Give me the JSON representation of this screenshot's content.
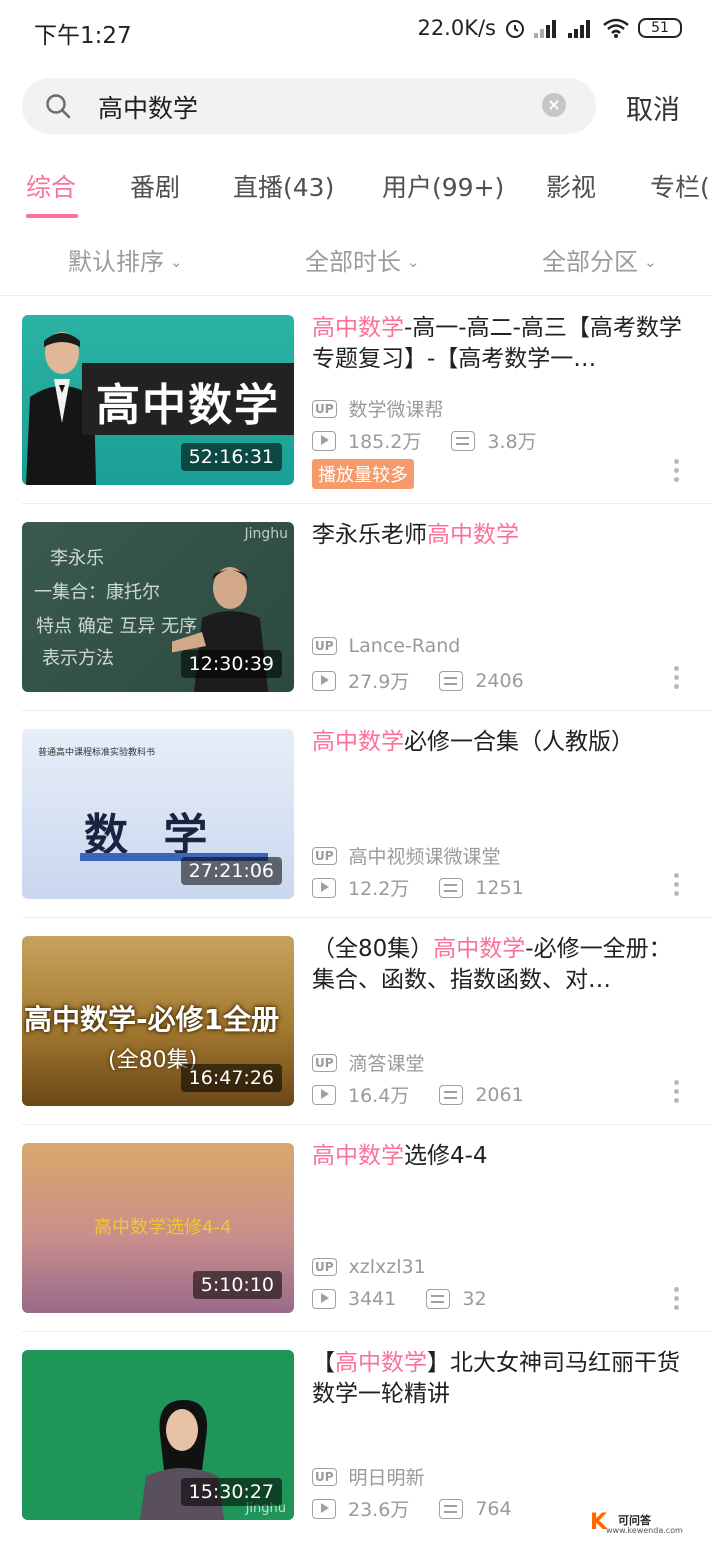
{
  "status_bar": {
    "time": "下午1:27",
    "network_speed": "22.0K/s",
    "battery": "51",
    "icons": [
      "alarm-icon",
      "signal-icon",
      "signal-icon",
      "wifi-icon",
      "battery-icon"
    ]
  },
  "search": {
    "query": "高中数学",
    "cancel_label": "取消"
  },
  "tabs": [
    {
      "label": "综合",
      "active": true
    },
    {
      "label": "番剧",
      "active": false
    },
    {
      "label": "直播(43)",
      "active": false
    },
    {
      "label": "用户(99+)",
      "active": false
    },
    {
      "label": "影视",
      "active": false
    },
    {
      "label": "专栏(",
      "active": false
    }
  ],
  "filters": {
    "sort": "默认排序",
    "duration": "全部时长",
    "zone": "全部分区"
  },
  "results": [
    {
      "title_hl": "高中数学",
      "title_rest": "-高一-高二-高三【高考数学专题复习】-【高考数学一…",
      "uploader": "数学微课帮",
      "views": "185.2万",
      "danmaku": "3.8万",
      "badge": "播放量较多",
      "duration": "52:16:31",
      "thumb_text": "高中数学"
    },
    {
      "title_pre": "李永乐老师",
      "title_hl": "高中数学",
      "uploader": "Lance-Rand",
      "views": "27.9万",
      "danmaku": "2406",
      "duration": "12:30:39",
      "thumb_text": "Jinghu"
    },
    {
      "title_hl": "高中数学",
      "title_rest": "必修一合集（人教版）",
      "uploader": "高中视频课微课堂",
      "views": "12.2万",
      "danmaku": "1251",
      "duration": "27:21:06",
      "thumb_text": "数 学"
    },
    {
      "title_pre": "（全80集）",
      "title_hl": "高中数学",
      "title_rest": "-必修一全册：集合、函数、指数函数、对…",
      "uploader": "滴答课堂",
      "views": "16.4万",
      "danmaku": "2061",
      "duration": "16:47:26",
      "thumb_text": "高中数学-必修1全册",
      "thumb_sub": "(全80集)"
    },
    {
      "title_hl": "高中数学",
      "title_rest": "选修4-4",
      "uploader": "xzlxzl31",
      "views": "3441",
      "danmaku": "32",
      "duration": "5:10:10",
      "thumb_text": "高中数学选修4-4"
    },
    {
      "title_pre": "【",
      "title_hl": "高中数学",
      "title_rest": "】北大女神司马红丽干货数学一轮精讲",
      "uploader": "明日明新",
      "views": "23.6万",
      "danmaku": "764",
      "duration": "15:30:27",
      "thumb_text": "Jinghu"
    }
  ],
  "watermark": {
    "logo_text": "可问答",
    "url": "www.kewenda.com"
  },
  "colors": {
    "accent": "#fb7299",
    "hot_badge": "#f59b6b",
    "muted": "#9a9a9a"
  }
}
